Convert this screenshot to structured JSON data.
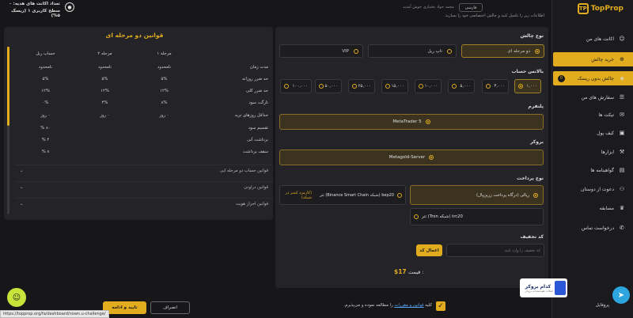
{
  "topbar": {
    "title_line1": "تعداد اکانت های هدیه: ۰",
    "title_line2": "سطح کاربری ۱ (ریسک ۵%)",
    "lang": "فارسی",
    "welcome": "محمد جواد بختیاری خوش آمدید",
    "subtitle": "اطلاعات زیر را تکمیل کنید و چالش اختصاصی خود را بسازید."
  },
  "sidebar": {
    "brand": "TopProp",
    "items": [
      {
        "label": "اکانت های من",
        "icon": "user-icon"
      },
      {
        "label": "خرید چالش",
        "icon": "cart-icon"
      },
      {
        "label": "چالش بدون ریسک",
        "badge": "0",
        "icon": "shield-icon"
      },
      {
        "label": "سفارش های من",
        "icon": "list-icon"
      },
      {
        "label": "تیکت ها",
        "icon": "chat-icon"
      },
      {
        "label": "کیف پول",
        "icon": "wallet-icon"
      },
      {
        "label": "ابزارها",
        "icon": "tools-icon"
      },
      {
        "label": "گواهینامه ها",
        "icon": "certificate-icon"
      },
      {
        "label": "دعوت از دوستان",
        "icon": "invite-icon"
      },
      {
        "label": "مسابقه",
        "icon": "trophy-icon"
      },
      {
        "label": "درخواست تماس",
        "icon": "phone-icon"
      }
    ],
    "profile": "پروفایل"
  },
  "form": {
    "challenge_type_label": "نوع چالش",
    "challenge_types": [
      "دو مرحله ای",
      "تاپ ریل",
      "VIP"
    ],
    "balance_label": "بالانس حساب",
    "balances": [
      "۱,۰۰۰",
      "۳,۰۰۰",
      "۵,۰۰۰",
      "۱۰,۰۰۰",
      "۱۵,۰۰۰",
      "۲۵,۰۰۰",
      "۵۰,۰۰۰",
      "۱۰۰,۰۰۰"
    ],
    "platform_label": "پلتفرم",
    "platform": "MetaTrader 5",
    "broker_label": "بروکر",
    "broker": "Metagold-Server",
    "payment_label": "نوع پرداخت",
    "payment_rial": "ریالی (درگاه پرداخت زرین‌پال)",
    "payment_bep20": "bep20 (شبکه Binance Smart Chain) تتر",
    "payment_bep20_note": "(کارمزد کمتر در شبکه)",
    "payment_trc20": "trc20 (شبکه Tron) تتر",
    "discount_label": "کد تخفیف",
    "discount_placeholder": "کد تخفیف را وارد کنید",
    "discount_apply": "اعمال کد",
    "price_label": "قیمت :",
    "price_value": "$17"
  },
  "rules": {
    "title": "قوانین دو مرحله ای",
    "headers": [
      "",
      "مرحله ۱",
      "مرحله ۲",
      "حساب ریل"
    ],
    "rows": [
      [
        "مدت زمان",
        "نامحدود",
        "نامحدود",
        "نامحدود"
      ],
      [
        "حد ضرر روزانه",
        "۵%",
        "۵%",
        "۵%"
      ],
      [
        "حد ضرر کلی",
        "۱۲%",
        "۱۲%",
        "۱۲%"
      ],
      [
        "تارگت سود",
        "۸%",
        "۴%",
        "۰%"
      ],
      [
        "حداقل روزهای ترید",
        "۰ روز",
        "۰ روز",
        "۰ روز"
      ],
      [
        "تقسیم سود",
        "",
        "",
        "۸۰ %"
      ],
      [
        "برداشت آنی",
        "",
        "",
        "۴ %"
      ],
      [
        "سقف برداشت",
        "",
        "",
        "۸ %"
      ]
    ],
    "links": [
      "قوانین حساب دو مرحله ایی",
      "قوانین دراودن",
      "قوانین احراز هویت"
    ]
  },
  "footer": {
    "agree_prefix": "کلیه",
    "agree_link": "قوانین و مقررات",
    "agree_suffix": "را مطالعه نموده و می‌پذیرم.",
    "cancel": "انصراف",
    "confirm": "تایید و ادامه",
    "url": "https://topprop.org/fa/dashboard/nown.u-challenge/",
    "badge_title": "کدام بروکر",
    "badge_sub": "انتخاب هوشمندانه بروکر"
  },
  "colors": {
    "accent": "#e2ac1f",
    "bg": "#17171a",
    "panel": "#242428"
  }
}
